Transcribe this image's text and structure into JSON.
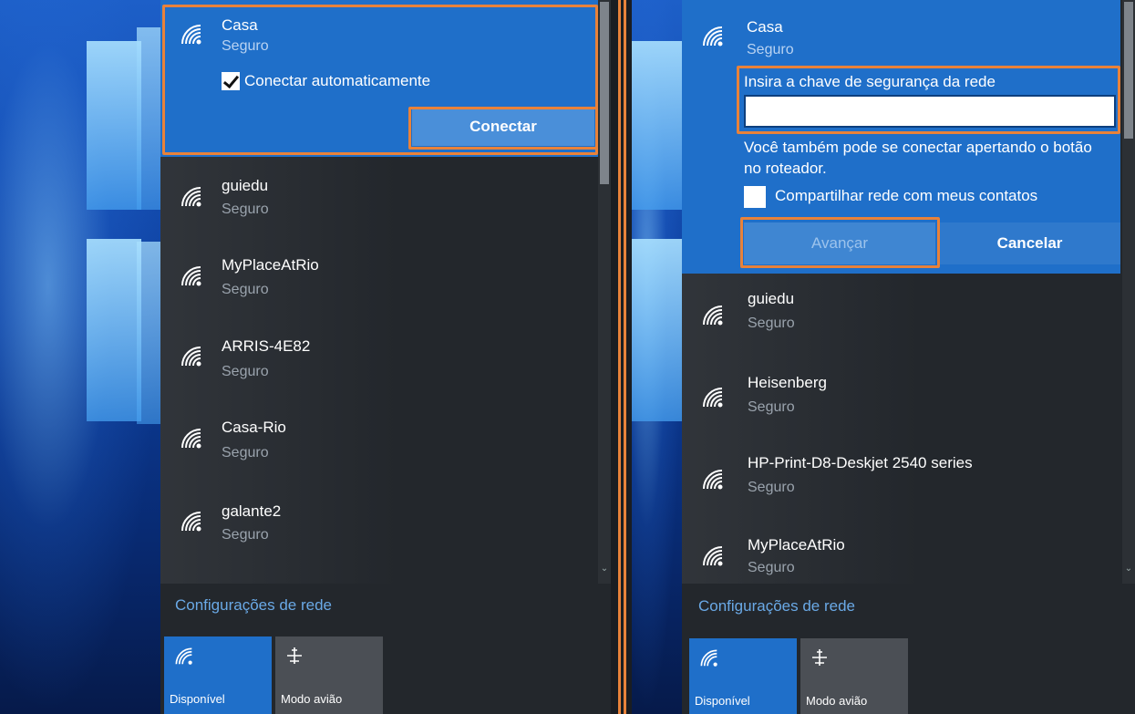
{
  "left_panel": {
    "expanded_network": {
      "ssid": "Casa",
      "status": "Seguro",
      "auto_connect_label": "Conectar automaticamente",
      "auto_connect_checked": true,
      "connect_label": "Conectar"
    },
    "networks": [
      {
        "ssid": "guiedu",
        "status": "Seguro"
      },
      {
        "ssid": "MyPlaceAtRio",
        "status": "Seguro"
      },
      {
        "ssid": "ARRIS-4E82",
        "status": "Seguro"
      },
      {
        "ssid": "Casa-Rio",
        "status": "Seguro"
      },
      {
        "ssid": "galante2",
        "status": "Seguro"
      }
    ],
    "settings_link": "Configurações de rede",
    "tiles": [
      {
        "label": "Disponível",
        "icon": "wifi-icon",
        "active": true
      },
      {
        "label": "Modo avião",
        "icon": "airplane-icon",
        "active": false
      }
    ]
  },
  "right_panel": {
    "expanded_network": {
      "ssid": "Casa",
      "status": "Seguro",
      "key_label": "Insira a chave de segurança da rede",
      "key_value": "",
      "info": "Você também pode se conectar apertando o botão no roteador.",
      "share_label": "Compartilhar rede com meus contatos",
      "share_checked": false,
      "next_label": "Avançar",
      "cancel_label": "Cancelar"
    },
    "networks": [
      {
        "ssid": "guiedu",
        "status": "Seguro"
      },
      {
        "ssid": "Heisenberg",
        "status": "Seguro"
      },
      {
        "ssid": "HP-Print-D8-Deskjet 2540 series",
        "status": "Seguro"
      },
      {
        "ssid": "MyPlaceAtRio",
        "status": "Seguro"
      }
    ],
    "settings_link": "Configurações de rede",
    "tiles": [
      {
        "label": "Disponível",
        "icon": "wifi-icon",
        "active": true
      },
      {
        "label": "Modo avião",
        "icon": "airplane-icon",
        "active": false
      }
    ]
  },
  "colors": {
    "accent": "#1f6fc9",
    "highlight": "#e8823a",
    "panel_bg": "#23272c",
    "link": "#6aa9e6"
  }
}
